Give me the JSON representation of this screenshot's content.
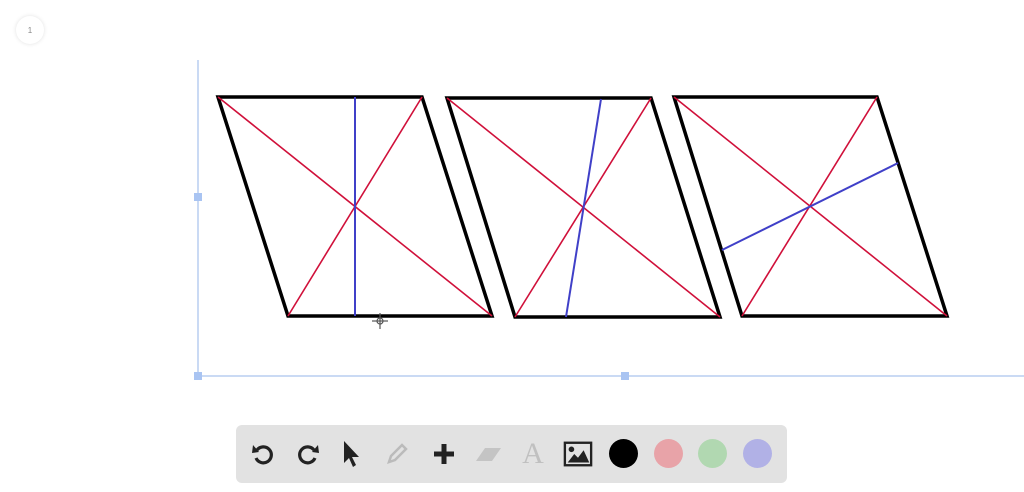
{
  "page": {
    "number": "1"
  },
  "toolbar": {
    "tools": [
      "undo",
      "redo",
      "select",
      "pencil",
      "add",
      "eraser",
      "text",
      "image"
    ],
    "text_tool_glyph": "A",
    "colors": {
      "black": "#000000",
      "red": "#e8a3a8",
      "green": "#b1d8b1",
      "blue": "#b1b1e6"
    }
  },
  "drawing": {
    "stroke_colors": {
      "outline": "#000000",
      "diagonal": "#d0103a",
      "segment": "#4040c8",
      "selection": "#b8cdf0"
    }
  }
}
